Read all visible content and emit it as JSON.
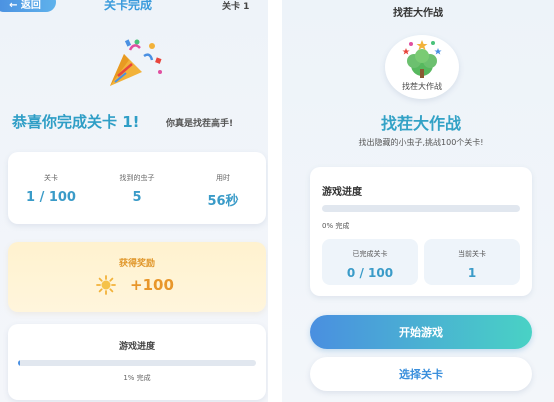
{
  "left": {
    "back_label": "← 返回",
    "title": "关卡完成",
    "level_tag": "关卡 1",
    "congrats": "恭喜你完成关卡 1!",
    "praise": "你真是找茬高手!",
    "stats": [
      {
        "label": "关卡",
        "value": "1 / 100"
      },
      {
        "label": "找到的虫子",
        "value": "5"
      },
      {
        "label": "用时",
        "value": "56秒"
      }
    ],
    "reward": {
      "title": "获得奖励",
      "value": "+100",
      "icon": "sun-coin-icon"
    },
    "progress": {
      "title": "游戏进度",
      "percent": 1,
      "text": "1% 完成"
    }
  },
  "right": {
    "header": "找茬大作战",
    "logo_text": "找茬大作战",
    "title": "找茬大作战",
    "subtitle": "找出隐藏的小虫子,挑战100个关卡!",
    "progress": {
      "title": "游戏进度",
      "percent": 0,
      "text": "0% 完成",
      "completed_label": "已完成关卡",
      "completed_value": "0 / 100",
      "current_label": "当前关卡",
      "current_value": "1"
    },
    "start_button": "开始游戏",
    "select_button": "选择关卡"
  },
  "colors": {
    "accent_blue": "#3a9bdc",
    "teal": "#49d2c5",
    "reward_orange": "#e8962a"
  }
}
